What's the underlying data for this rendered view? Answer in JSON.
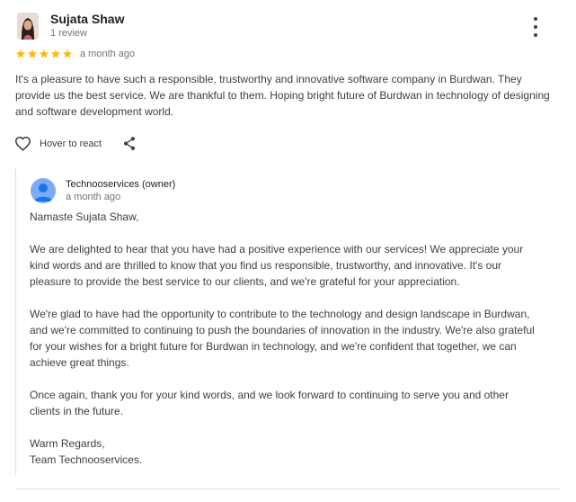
{
  "review": {
    "reviewer_name": "Sujata Shaw",
    "review_count": "1 review",
    "rating": 5,
    "date": "a month ago",
    "text": "It's a pleasure to have such a responsible, trustworthy and innovative software company in Burdwan. They provide us the best service. We are thankful to them. Hoping bright future of Burdwan in technology of designing and software development world.",
    "react_label": "Hover to react"
  },
  "owner_reply": {
    "name": "Technooservices (owner)",
    "date": "a month ago",
    "greeting": "Namaste Sujata Shaw,",
    "paragraphs": [
      "We are delighted to hear that you have had a positive experience with our services! We appreciate your kind words and are thrilled to know that you find us responsible, trustworthy, and innovative. It's our pleasure to provide the best service to our clients, and we're grateful for your appreciation.",
      "We're glad to have had the opportunity to contribute to the technology and design landscape in Burdwan, and we're committed to continuing to push the boundaries of innovation in the industry. We're also grateful for your wishes for a bright future for Burdwan in technology, and we're confident that together, we can achieve great things.",
      "Once again, thank you for your kind words, and we look forward to continuing to serve you and other clients in the future."
    ],
    "closing": "Warm Regards,",
    "signature": "Team Technooservices."
  },
  "colors": {
    "star": "#fbbc04",
    "text": "#3c4043",
    "secondary_text": "#70757a",
    "divider": "#dadce0",
    "owner_avatar": "#7baaf7"
  },
  "icons": [
    "more-vert-icon",
    "star-icon",
    "heart-outline-icon",
    "share-icon",
    "person-icon"
  ]
}
